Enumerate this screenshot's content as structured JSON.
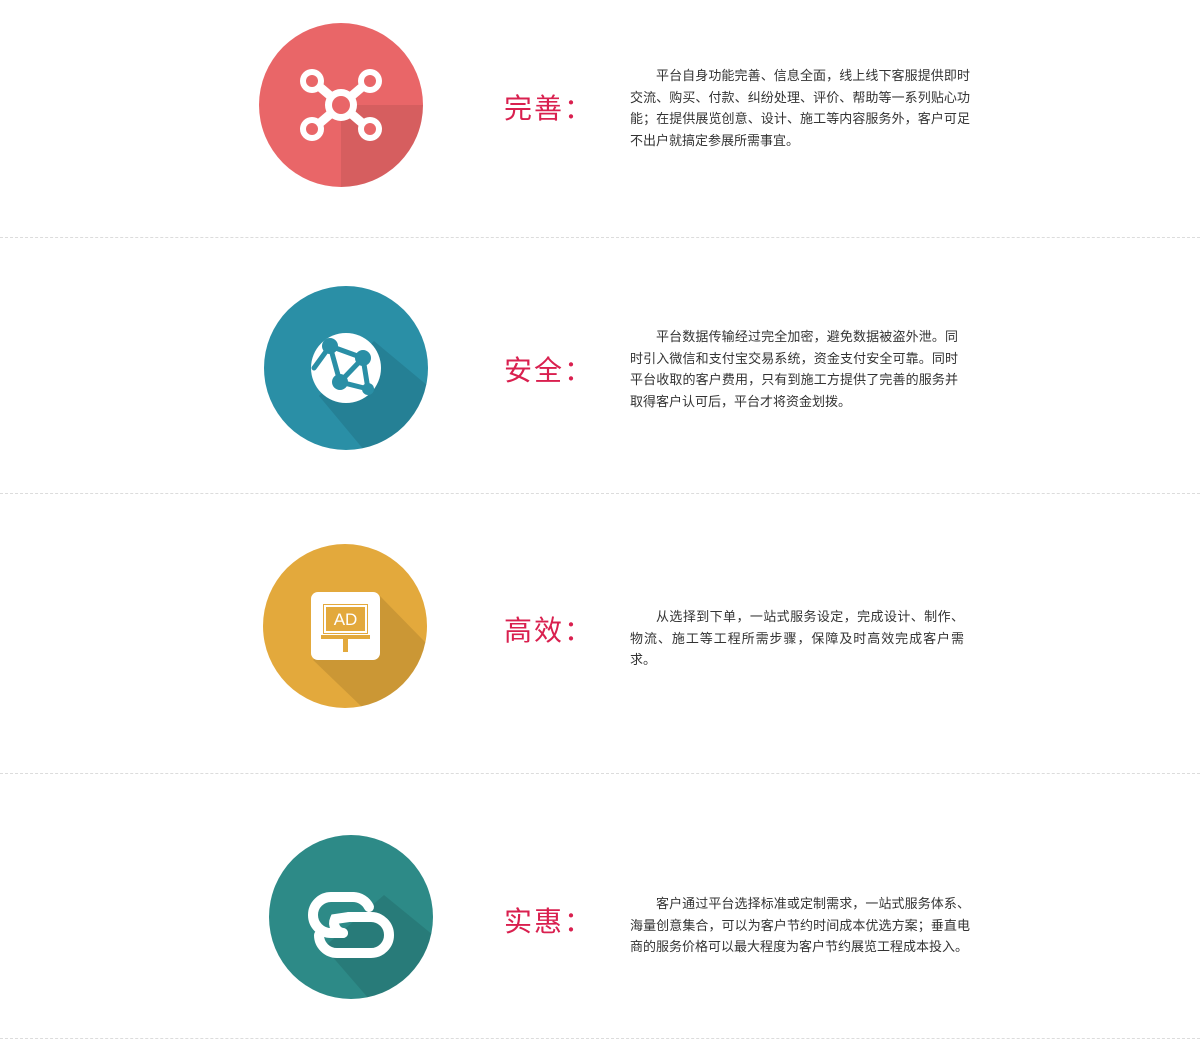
{
  "features": [
    {
      "title": "完善：",
      "icon": "network-hub-icon",
      "color": "#e96668",
      "description": "平台自身功能完善、信息全面，线上线下客服提供即时交流、购买、付款、纠纷处理、评价、帮助等一系列贴心功能；在提供展览创意、设计、施工等内容服务外，客户可足不出户就搞定参展所需事宜。"
    },
    {
      "title": "安全：",
      "icon": "globe-network-icon",
      "color": "#2a8fa6",
      "description": "平台数据传输经过完全加密，避免数据被盗外泄。同时引入微信和支付宝交易系统，资金支付安全可靠。同时平台收取的客户费用，只有到施工方提供了完善的服务并取得客户认可后，平台才将资金划拨。"
    },
    {
      "title": "高效：",
      "icon": "ad-board-icon",
      "color": "#e3a93c",
      "icon_text": "AD",
      "description": "从选择到下单，一站式服务设定，完成设计、制作、物流、施工等工程所需步骤，保障及时高效完成客户需求。"
    },
    {
      "title": "实惠：",
      "icon": "link-chain-icon",
      "color": "#2d8a87",
      "description": "客户通过平台选择标准或定制需求，一站式服务体系、海量创意集合，可以为客户节约时间成本优选方案；垂直电商的服务价格可以最大程度为客户节约展览工程成本投入。"
    }
  ]
}
